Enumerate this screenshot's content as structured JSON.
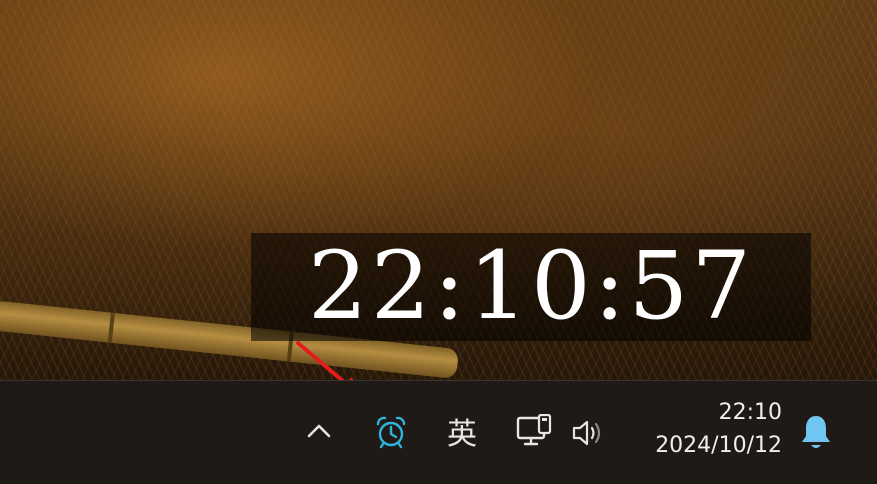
{
  "desktop": {
    "clock_widget": {
      "time": "22:10:57"
    }
  },
  "taskbar": {
    "tray": {
      "overflow_icon": "chevron-up-icon",
      "alarm_icon": "alarm-clock-icon",
      "ime_label": "英",
      "network_icon": "network-icon",
      "volume_icon": "volume-icon"
    },
    "clock": {
      "time": "22:10",
      "date": "2024/10/12"
    },
    "notification_icon": "bell-icon"
  },
  "annotation": {
    "arrow_icon": "red-arrow-icon",
    "color": "#e41c1c"
  },
  "colors": {
    "taskbar_bg": "#1f1a16",
    "alarm_accent": "#2fb4e0",
    "bell_accent": "#6fc6f0",
    "text": "#f2efeb"
  }
}
